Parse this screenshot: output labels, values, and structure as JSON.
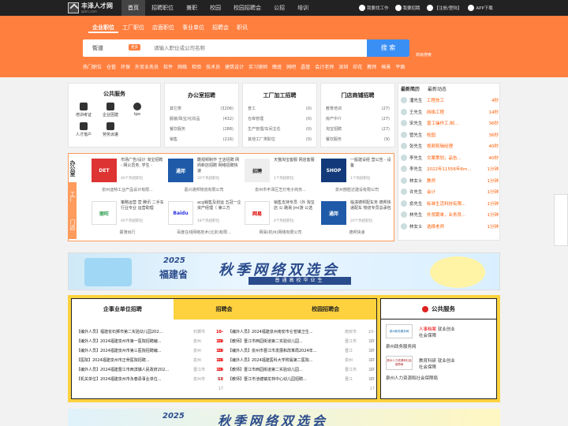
{
  "topbar": {
    "logo_text": "丰泽人才网",
    "logo_sub": "qztrc.com",
    "nav": [
      "首页",
      "招聘职位",
      "兼职",
      "校园",
      "校园招聘会",
      "公招",
      "培训"
    ],
    "right": [
      "我要找工作",
      "我要招聘",
      "【注册/登陆】",
      "APP下载"
    ]
  },
  "subtabs": [
    "企业职位",
    "工厂职位",
    "店面职位",
    "事业单位",
    "招聘会",
    "职讯"
  ],
  "search": {
    "city": "街道",
    "badge": "更多",
    "placeholder": "请输入职位或公司名称",
    "button": "搜 索",
    "advanced": "高级搜索"
  },
  "hotlinks": [
    "热门职位",
    "仓管",
    "环保",
    "外贸业务员",
    "软件",
    "网络",
    "检验",
    "技术员",
    "建筑设计",
    "实习律师",
    "晚班",
    "网吧",
    "晶管",
    "会计老师",
    "深圳",
    "印花",
    "教师",
    "格景",
    "平面"
  ],
  "services": {
    "title": "公共服务",
    "items": [
      "培训考证",
      "企业团建",
      "tpo",
      "人才落户",
      "劳务派遣"
    ]
  },
  "job_cols": [
    {
      "title": "办公室招聘",
      "rows": [
        [
          "其它类",
          "(3206)"
        ],
        [
          "服装/珠宝/化妆品",
          "(432)"
        ],
        [
          "餐饮服务",
          "(288)"
        ],
        [
          "销售",
          "(216)"
        ]
      ]
    },
    {
      "title": "工厂加工招聘",
      "rows": [
        [
          "普工",
          "(0)"
        ],
        [
          "仓库管理",
          "(0)"
        ],
        [
          "生产管理/车间主任",
          "(0)"
        ],
        [
          "其他工厂类职位",
          "(0)"
        ]
      ]
    },
    {
      "title": "门店商铺招聘",
      "rows": [
        [
          "教育培训",
          "(27)"
        ],
        [
          "房产中介",
          "(27)"
        ],
        [
          "淘宝招聘",
          "(27)"
        ],
        [
          "餐饮服务",
          "(9)"
        ]
      ]
    }
  ],
  "latest": {
    "tabs": [
      "最新简历",
      "最新动态"
    ],
    "rows": [
      [
        "潘先生",
        "工程技工",
        "4秒"
      ],
      [
        "王先生",
        "网络工程",
        "14秒"
      ],
      [
        "宋先生",
        "普工操作工,制...",
        "36秒"
      ],
      [
        "管先生",
        "校园",
        "36秒"
      ],
      [
        "张先生",
        "视频剪辑经理",
        "40秒"
      ],
      [
        "李先生",
        "文案策划，品告...",
        "40秒"
      ],
      [
        "李先生",
        "2022年11556年6m...",
        "1分钟"
      ],
      [
        "林女士",
        "教师",
        "1分钟"
      ],
      [
        "许先生",
        "会计",
        "1分钟"
      ],
      [
        "俞先生",
        "标准生活科技有限...",
        "1分钟"
      ],
      [
        "林先生",
        "外贸跟单，业务员...",
        "1分钟"
      ],
      [
        "林女士",
        "选择老师",
        "1分钟"
      ]
    ]
  },
  "company": {
    "vtabs": [
      "办公室",
      "工厂",
      "门店"
    ],
    "items": [
      {
        "logo": "DET",
        "desc": "市场广告/设计 淘宝招聘 - 网公员务, 学生 -",
        "note": "40个热招职位",
        "name": "泉州迪特工业产品设计有限..."
      },
      {
        "logo": "通邦",
        "desc": "酷视频制作 王店招聘 网商新店招聘 网络招聘快速",
        "note": "20个热招职位",
        "name": "嘉兴通邦物流有限公司"
      },
      {
        "logo": "招聘",
        "desc": "天猫淘宝客服 网店客服",
        "note": "1个热招职位",
        "name": "泉州市丰泽区芝灯电子商务..."
      },
      {
        "logo": "SHOP",
        "desc": "一般建设经 营公告 - 设备",
        "note": "1个热招职位",
        "name": "泉州丽胜达建设有限公司"
      },
      {
        "logo": "丽旺",
        "desc": "策略运营 营 腾讯 二手车 行业专业 运营助理",
        "note": "40个热招职位",
        "name": "霍骑出行"
      },
      {
        "logo": "Baidu",
        "desc": "acg销售及划运 五冠一企 资产经理（ 第三方",
        "note": "18个热招职位",
        "name": "百度在线网络技术(北京)有限..."
      },
      {
        "logo": "网易",
        "desc": "销售支持专员（外 淘宝店 公 路易 Jmi游 公选",
        "note": "4个热招职位",
        "name": "网易(杭州)网络有限公司"
      },
      {
        "logo": "通邦",
        "desc": "临潼德邦配车务 德邦快递配车 物流专员总承包",
        "note": "20个热招职位",
        "name": "德邦快递"
      }
    ]
  },
  "banner": {
    "year": "2025",
    "province": "福建省",
    "title": "秋季网络双选会",
    "subtitle": "普通高校毕业生"
  },
  "recruit": {
    "tabs": [
      "企事业单位招聘",
      "招聘会",
      "校园招聘会"
    ],
    "left": [
      [
        "【编外人员】福建省石狮市第二实验幼儿园202...",
        "石狮市",
        "10-18"
      ],
      [
        "【编外人员】2024福建泉州市第一医院招聘编...",
        "泉州",
        "10-18"
      ],
      [
        "【编外人员】2024福建泉州市第三医院招聘编...",
        "泉州",
        "10-18"
      ],
      [
        "【医院】2024福建泉州市正骨医院招聘...",
        "泉州",
        "10-18"
      ],
      [
        "【编外人员】2024福建晋江市西滨镇人民政府202...",
        "晋江市",
        "10-18"
      ],
      [
        "【机关单位】2024福建泉州市永春县事业单位...",
        "泉州市",
        "10-17"
      ]
    ],
    "right": [
      [
        "【编外人员】2024福建泉州南安市仑苍镇卫生...",
        "南安市",
        "10-17"
      ],
      [
        "【教师】晋江市西园街道第二实验幼儿园...",
        "晋江市",
        "10-17"
      ],
      [
        "【编外人员】泉州市晋江市发展和改革局2024年...",
        "晋江",
        "10-17"
      ],
      [
        "【编外人员】2024福建医科大学附属第二医院...",
        "泉州",
        "10-17"
      ],
      [
        "【教师】晋江市西园街道第二实验幼儿园...",
        "晋江市",
        "10-17"
      ],
      [
        "【教师】晋江市池塘镇龙林中心幼儿园招聘...",
        "晋江",
        "10-17"
      ]
    ]
  },
  "public": {
    "title": "公共服务",
    "items": [
      {
        "logo": "泉州政务服务网",
        "t1": "人事档案",
        "t1b": "就业创业",
        "t2": "社会保障",
        "name": "泉州政务服务网"
      },
      {
        "logo": "泉州人力资源和社会保障局",
        "t1": "教育科研",
        "t1b": "就业创业",
        "t2": "社会保障",
        "name": "泉州人力资源和社会保障局"
      }
    ]
  },
  "bottom_banner": {
    "year": "2025",
    "title": "秋季网络双选会"
  },
  "colors": {
    "orange": "#ff7f3f",
    "blue": "#3a8ff5",
    "yellow": "#fdd23e",
    "navy": "#2b4c8c"
  }
}
